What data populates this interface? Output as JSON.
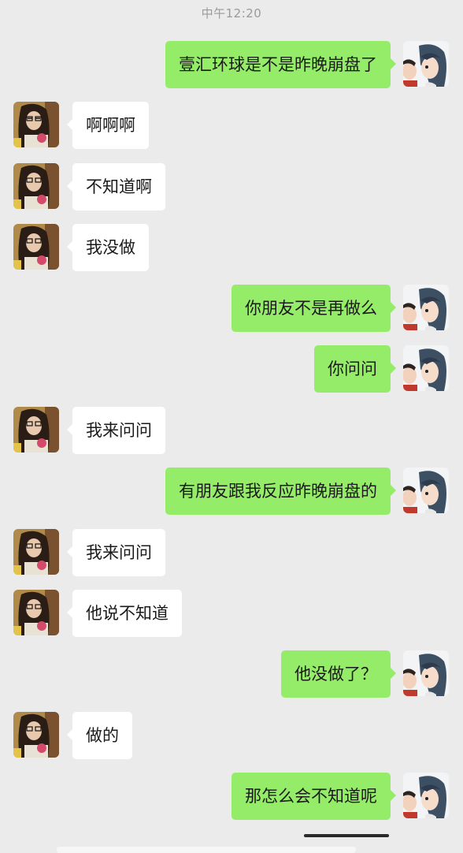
{
  "timestamp": "中午12:20",
  "messages": [
    {
      "side": "outgoing",
      "text": "壹汇环球是不是昨晚崩盘了"
    },
    {
      "side": "incoming",
      "text": "啊啊啊"
    },
    {
      "side": "incoming",
      "text": "不知道啊"
    },
    {
      "side": "incoming",
      "text": "我没做"
    },
    {
      "side": "outgoing",
      "text": "你朋友不是再做么"
    },
    {
      "side": "outgoing",
      "text": "你问问"
    },
    {
      "side": "incoming",
      "text": "我来问问"
    },
    {
      "side": "outgoing",
      "text": "有朋友跟我反应昨晚崩盘的"
    },
    {
      "side": "incoming",
      "text": "我来问问"
    },
    {
      "side": "incoming",
      "text": "他说不知道"
    },
    {
      "side": "outgoing",
      "text": "他没做了？"
    },
    {
      "side": "incoming",
      "text": "做的"
    },
    {
      "side": "outgoing",
      "text": "那怎么会不知道呢"
    }
  ],
  "colors": {
    "background": "#ebebeb",
    "outgoing_bubble": "#95ec69",
    "incoming_bubble": "#ffffff"
  },
  "icons": {
    "incoming_avatar": "contact-photo-avatar",
    "outgoing_avatar": "cartoon-character-avatar"
  }
}
